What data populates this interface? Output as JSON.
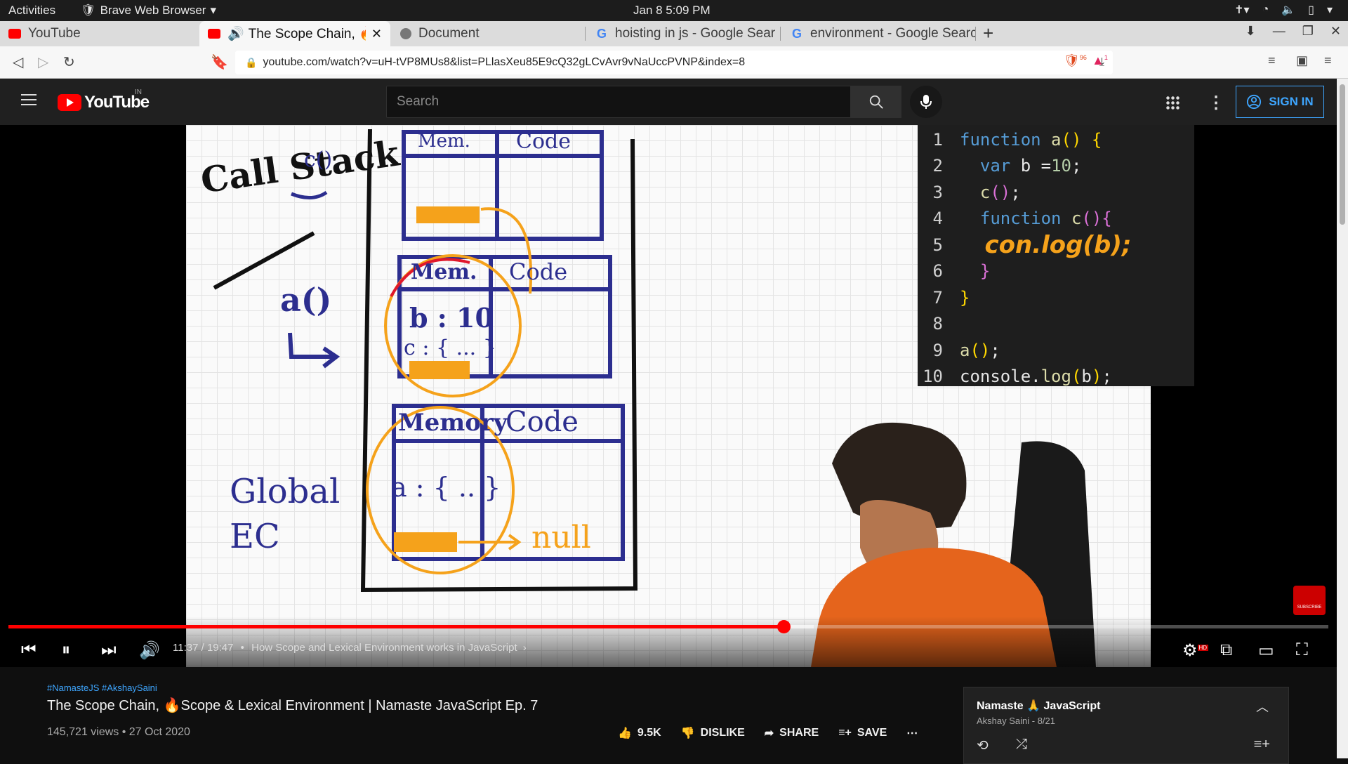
{
  "os": {
    "activities": "Activities",
    "app_name": "Brave Web Browser",
    "clock": "Jan 8  5:09 PM"
  },
  "browser": {
    "tabs": [
      {
        "label": "YouTube",
        "active": false
      },
      {
        "label": "The Scope Chain, 🔥Sc",
        "active": true
      },
      {
        "label": "Document",
        "active": false
      },
      {
        "label": "hoisting in js - Google Sear",
        "active": false
      },
      {
        "label": "environment - Google Searc",
        "active": false
      }
    ],
    "url": "youtube.com/watch?v=uH-tVP8MUs8&list=PLlasXeu85E9cQ32gLCvAvr9vNaUccPVNP&index=8",
    "shield_count": "96",
    "rewards_badge": "1"
  },
  "youtube": {
    "logo_text": "YouTube",
    "country_code": "IN",
    "search_placeholder": "Search",
    "sign_in": "SIGN IN"
  },
  "video": {
    "whiteboard": {
      "call_stack_label": "Call Stack",
      "c_label": "c()",
      "a_label": "a()",
      "global_label": "Global EC",
      "memory_label": "Mem.",
      "memory_label_2": "Memory",
      "code_label": "Code",
      "b_entry": "b : 10",
      "c_entry": "c : { ... }",
      "a_entry": "a : { .. }",
      "null_label": "null"
    },
    "code_lines": [
      {
        "n": "1",
        "text": "function a() {"
      },
      {
        "n": "2",
        "text": "  var b =10;"
      },
      {
        "n": "3",
        "text": "  c();"
      },
      {
        "n": "4",
        "text": "  function c(){"
      },
      {
        "n": "5",
        "text": "   con.log(b);"
      },
      {
        "n": "6",
        "text": "  }"
      },
      {
        "n": "7",
        "text": "}"
      },
      {
        "n": "8",
        "text": ""
      },
      {
        "n": "9",
        "text": "a();"
      },
      {
        "n": "10",
        "text": "console.log(b);"
      }
    ],
    "current_time": "11:37",
    "duration": "19:47",
    "chapter": "How Scope and Lexical Environment works in JavaScript",
    "progress_fraction": 0.587,
    "buffered_fraction": 0.61,
    "subscribe_badge": "SUBSCRIBE",
    "hd_badge": "HD"
  },
  "details": {
    "hashtags": "#NamasteJS #AkshaySaini",
    "title": "The Scope Chain, 🔥Scope & Lexical Environment | Namaste JavaScript Ep. 7",
    "views": "145,721 views • 27 Oct 2020",
    "likes": "9.5K",
    "dislike": "DISLIKE",
    "share": "SHARE",
    "save": "SAVE"
  },
  "playlist": {
    "title": "Namaste 🙏 JavaScript",
    "subtitle": "Akshay Saini - 8/21"
  },
  "colors": {
    "accent_red": "#ff0000",
    "link_blue": "#3ea6ff",
    "marker_blue": "#2c2e8f",
    "marker_orange": "#f5a21b"
  }
}
